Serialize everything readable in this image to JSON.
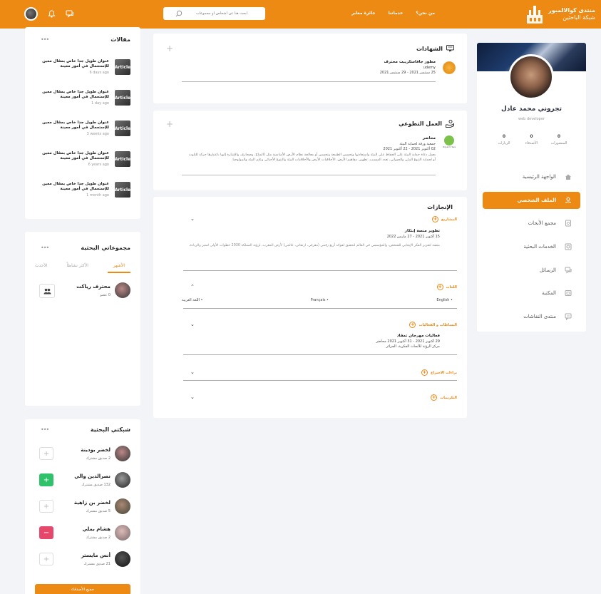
{
  "topbar": {
    "brand_title": "منتدى كوالالمبور",
    "brand_subtitle": "شبكة الباحثين",
    "nav": [
      "من نحن؟",
      "خدماتنا",
      "جائزة معابر"
    ],
    "search_placeholder": "ابحث هنا عن أشخاص أو مجموعات",
    "icons": [
      "search-icon",
      "bell-icon",
      "chat-icon"
    ]
  },
  "profile": {
    "name": "تجروني محمد عادل",
    "role": "web developer",
    "stats": [
      {
        "value": "0",
        "label": "المنشورات"
      },
      {
        "value": "0",
        "label": "الأصدقاء"
      },
      {
        "value": "0",
        "label": "الزيارات"
      }
    ],
    "menu": [
      {
        "label": "الواجهة الرئيسية",
        "icon": "home-icon"
      },
      {
        "label": "الملف الشخصي",
        "icon": "user-icon",
        "active": true
      },
      {
        "label": "مجمع الأبحاث",
        "icon": "document-icon"
      },
      {
        "label": "الخدمات البحثية",
        "icon": "services-icon"
      },
      {
        "label": "الرسائل",
        "icon": "messages-icon"
      },
      {
        "label": "المكتبة",
        "icon": "library-icon"
      },
      {
        "label": "منتدى النقاشات",
        "icon": "forum-icon"
      }
    ]
  },
  "certificates": {
    "title": "الشهادات",
    "entry": {
      "name": "مطور جافاسكريبت محترف",
      "org": "udemy",
      "dates": "25 سبتمبر 2021 - 29 سبتمبر 2021"
    }
  },
  "volunteer": {
    "title": "العمل التطوعي",
    "entry": {
      "role": "محاضر",
      "org": "جمعية ورقة لحماية البيئة",
      "dates": "02 أكتوبر 2021 - 22 أكتوبر 2021",
      "desc": "يعمل دعاة حماية البيئة على الحفاظ على البيئة واستعادتها وتحسين الطبيعة وتحسين أو معالجة نظام الأرض الأساسية مثل (المناخ، وصحاري، والإشارة إليها باعتبارها حركة للتلوث أو لحماية التنوع البيئي والحيواني، تعدد المسبب، تطهير، مفاهيم الأرض، الأخلاقيات الأرض والأخلاقيات البيئة والتنوع الأحيائي وعلم البيئة والبيولوجيا."
    },
    "logo_text": "Organic Sea"
  },
  "achievements": {
    "title": "الإنجازات",
    "projects": {
      "label": "المشاريع",
      "title": "تطوير منصة إبتكار",
      "dates": "15 أكتوبر 2021 - 27 مارس 2022",
      "desc": "منصة لتعزيز الفكر الإيجابي للشخص، والمؤسسي في العالم لتحقيق لفوائد أربع رقمي (معرفي، ارتقائي، عالمي) لأرض المغرب، لرؤية المملكة 2030 خطوات الأولى لتميز والريادة."
    },
    "languages": {
      "label": "اللغات",
      "items": [
        "English",
        "Français",
        "اللغة العربية"
      ]
    },
    "activities": {
      "label": "النشاطات و الفعاليات",
      "title": "فعاليات مهرجان تمقاد",
      "dates": "29 أكتوبر 2021 - 31 أكتوبر 2021 محاضر",
      "place": "مركز الرؤية للأبحاث الفكرية، الجزائر"
    },
    "patents": {
      "label": "براءات الاختراع"
    },
    "honors": {
      "label": "التكريمات"
    }
  },
  "articles": {
    "title": "مقالات",
    "thumb_label": "Article",
    "items": [
      {
        "title": "عنوان طويل جدا خاص بمقال معين للإستعمال في أمور معينة",
        "date": "6 days ago"
      },
      {
        "title": "عنوان طويل جدا خاص بمقال معين للإستعمال في أمور معينة",
        "date": "1 day ago"
      },
      {
        "title": "عنوان طويل جدا خاص بمقال معين للإستعمال في أمور معينة",
        "date": "3 weeks ago"
      },
      {
        "title": "عنوان طويل جدا خاص بمقال معين للإستعمال في أمور معينة",
        "date": "6 years ago"
      },
      {
        "title": "عنوان طويل جدا خاص بمقال معين للإستعمال في أمور معينة",
        "date": "1 month ago"
      }
    ]
  },
  "groups": {
    "title": "مجموعاتي البحثية",
    "tabs": [
      "الأشهر",
      "الأكثر نشاطاً",
      "الأحدث"
    ],
    "items": [
      {
        "name": "محترف رياكت",
        "members": "0 عضو"
      }
    ]
  },
  "network": {
    "title": "شبكتي البحثية",
    "people": [
      {
        "name": "لخضر بودينة",
        "mutual": "2 صديق مشترك",
        "action": "add"
      },
      {
        "name": "نصرالدين والي",
        "mutual": "132 صديق مشترك",
        "action": "friend"
      },
      {
        "name": "لخضر بن زاهية",
        "mutual": "5 صديق مشترك",
        "action": "add"
      },
      {
        "name": "هشام بملي",
        "mutual": "2 صديق مشترك",
        "action": "remove"
      },
      {
        "name": "أنس مايستر",
        "mutual": "21 صديق مشترك",
        "action": "add"
      }
    ],
    "all_friends": "جميع الأصدقاء"
  }
}
